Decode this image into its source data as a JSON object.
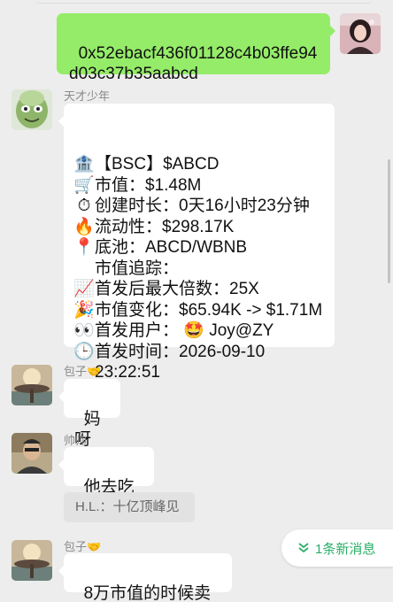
{
  "messages": {
    "m1": {
      "text": "0x52ebacf436f01128c4b03ffe94\nd03c37b35aabcd"
    },
    "m2": {
      "sender": "天才少年",
      "lines": [
        {
          "icon": "bank-icon",
          "glyph": "🏦",
          "text": "【BSC】$ABCD"
        },
        {
          "icon": "shopping-cart-icon",
          "glyph": "🛒",
          "text": "市值：$1.48M"
        },
        {
          "icon": "stopwatch-icon",
          "glyph": "⏱",
          "text": "创建时长：0天16小时23分钟"
        },
        {
          "icon": "fire-icon",
          "glyph": "🔥",
          "text": "流动性：$298.17K"
        },
        {
          "icon": "pin-icon",
          "glyph": "📍",
          "text": "底池：ABCD/WBNB"
        },
        {
          "icon": "",
          "glyph": "",
          "text": "市值追踪："
        },
        {
          "icon": "chart-up-icon",
          "glyph": "📈",
          "text": "首发后最大倍数：25X"
        },
        {
          "icon": "party-popper-icon",
          "glyph": "🎉",
          "text": "市值变化：$65.94K -> $1.71M"
        },
        {
          "icon": "eyes-icon",
          "glyph": "👀",
          "text": "首发用户： 🤩 Joy@ZY"
        },
        {
          "icon": "clock-icon",
          "glyph": "🕒",
          "text": "首发时间：2026-09-10"
        },
        {
          "icon": "",
          "glyph": "",
          "text": "23:22:51"
        }
      ]
    },
    "m3": {
      "sender": "包子🤝",
      "text": "妈呀"
    },
    "m4": {
      "sender": "帅帅",
      "text": "他去吃吧",
      "quote": "H.L.：十亿顶峰见"
    },
    "m5": {
      "sender": "包子🤝",
      "text": "8万市值的时候卖了"
    }
  },
  "new_messages_pill": {
    "label": "1条新消息",
    "icon": "double-chevron-down-icon"
  },
  "colors": {
    "green_bubble": "#95ec69",
    "accent_green": "#2aae67",
    "background": "#ededed"
  }
}
